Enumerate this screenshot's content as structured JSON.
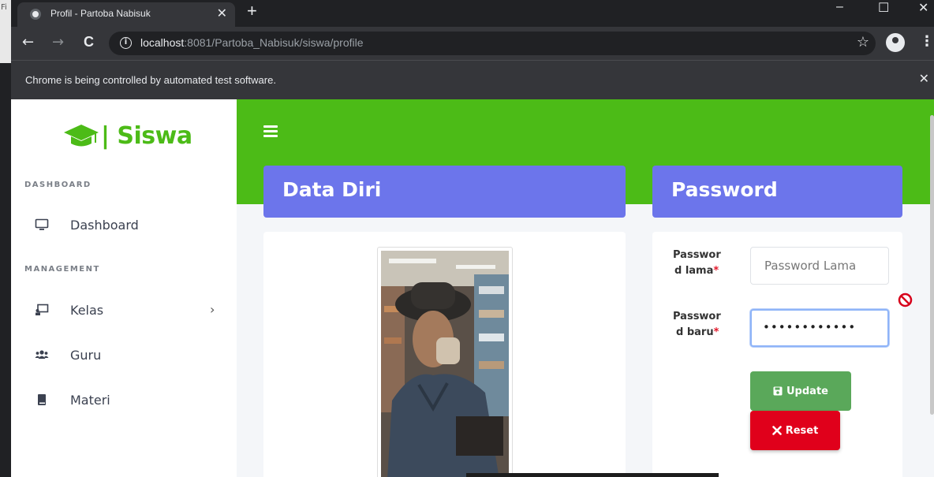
{
  "browser": {
    "edge_fragment": "Fi",
    "tab_title": "Profil - Partoba Nabisuk",
    "tab_close": "✕",
    "new_tab": "+",
    "window": {
      "minimize": "–",
      "maximize": "☐",
      "close": "✕"
    },
    "nav": {
      "back": "←",
      "forward": "→",
      "reload": "C"
    },
    "url_host": "localhost",
    "url_rest": ":8081/Partoba_Nabisuk/siswa/profile",
    "star": "☆",
    "menu": "⋮",
    "infobar_text": "Chrome is being controlled by automated test software.",
    "infobar_close": "✕"
  },
  "sidebar": {
    "brand": "| Siswa",
    "section_dashboard": "DASHBOARD",
    "section_management": "MANAGEMENT",
    "items": [
      {
        "label": "Dashboard",
        "icon": "monitor-icon"
      },
      {
        "label": "Kelas",
        "icon": "chalkboard-icon",
        "chevron": "›"
      },
      {
        "label": "Guru",
        "icon": "users-icon"
      },
      {
        "label": "Materi",
        "icon": "book-icon"
      }
    ]
  },
  "main": {
    "data_diri_title": "Data Diri",
    "password_title": "Password",
    "old_password_label_1": "Passwor",
    "old_password_label_2": "d lama",
    "new_password_label_1": "Passwor",
    "new_password_label_2": "d baru",
    "required_mark": "*",
    "old_password_placeholder": "Password Lama",
    "new_password_value": "••••••••••••",
    "update_label": "Update",
    "reset_label": "Reset"
  },
  "colors": {
    "brand_green": "#4cbb17",
    "card_header": "#6c75eb",
    "update_button": "#5aa85a",
    "reset_button": "#e0001b"
  }
}
